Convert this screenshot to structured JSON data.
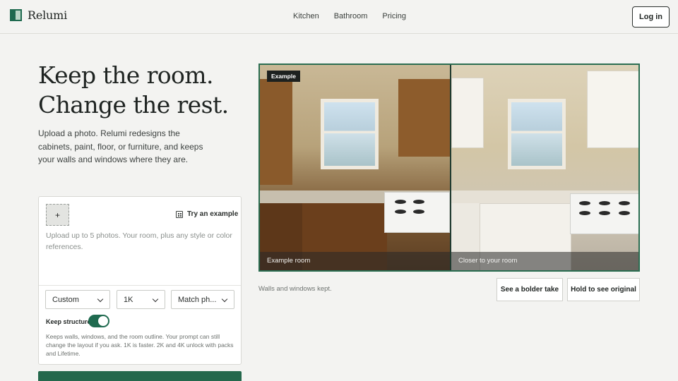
{
  "header": {
    "brand": "Relumi",
    "nav": [
      "Kitchen",
      "Bathroom",
      "Pricing"
    ],
    "login_label": "Log in"
  },
  "hero": {
    "headline_line1": "Keep the room.",
    "headline_line2": "Change the rest.",
    "subtext": "Upload a photo. Relumi redesigns the cabinets, paint, floor, or furniture, and keeps your walls and windows where they are."
  },
  "form": {
    "upload_label": "+",
    "try_example_label": "Try an example",
    "prompt_placeholder": "Upload up to 5 photos. Your room, plus any style or color references.",
    "style_select": "Custom",
    "resolution_select": "1K",
    "aspect_select": "Match ph...",
    "keep_structure_label": "Keep structure",
    "keep_structure_on": true,
    "keep_structure_note": "Keeps walls, windows, and the room outline. Your prompt can still change the layout if you ask. 1K is faster. 2K and 4K unlock with packs and Lifetime."
  },
  "compare": {
    "badge": "Example",
    "left_caption": "Example room",
    "right_caption": "Closer to your room",
    "note": "Walls and windows kept.",
    "bolder_label": "See a bolder take",
    "hold_label": "Hold to see original"
  },
  "colors": {
    "accent": "#1f6a4f",
    "background": "#f3f3f1"
  },
  "icons": [
    "logo-icon",
    "grid-icon",
    "chevron-down-icon",
    "plus-icon"
  ]
}
